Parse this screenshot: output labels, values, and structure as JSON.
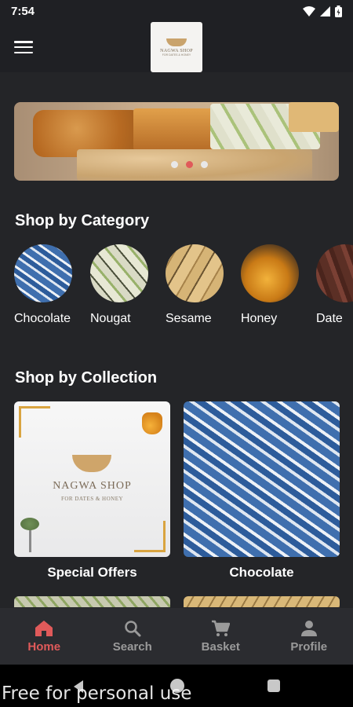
{
  "status_bar": {
    "time": "7:54"
  },
  "header": {
    "logo_brand": "NAGWA SHOP",
    "logo_sub": "FOR DATES & HONEY"
  },
  "categories": {
    "title": "Shop by Category",
    "items": [
      {
        "label": "Chocolate",
        "icon": "chocolate-image"
      },
      {
        "label": "Nougat",
        "icon": "nougat-image"
      },
      {
        "label": "Sesame",
        "icon": "sesame-image"
      },
      {
        "label": "Honey",
        "icon": "honey-image"
      },
      {
        "label": "Date",
        "icon": "dates-image"
      }
    ]
  },
  "collections": {
    "title": "Shop by Collection",
    "items": [
      {
        "label": "Special Offers",
        "shop_name": "NAGWA SHOP",
        "shop_sub": "FOR DATES & HONEY"
      },
      {
        "label": "Chocolate"
      }
    ]
  },
  "bottom_nav": [
    {
      "label": "Home",
      "icon": "home-icon",
      "active": true
    },
    {
      "label": "Search",
      "icon": "search-icon",
      "active": false
    },
    {
      "label": "Basket",
      "icon": "cart-icon",
      "active": false
    },
    {
      "label": "Profile",
      "icon": "person-icon",
      "active": false
    }
  ],
  "watermark": "Free for personal use",
  "colors": {
    "accent": "#e05a5a",
    "background": "#1f2024",
    "nav_inactive": "#9a9a9a"
  }
}
